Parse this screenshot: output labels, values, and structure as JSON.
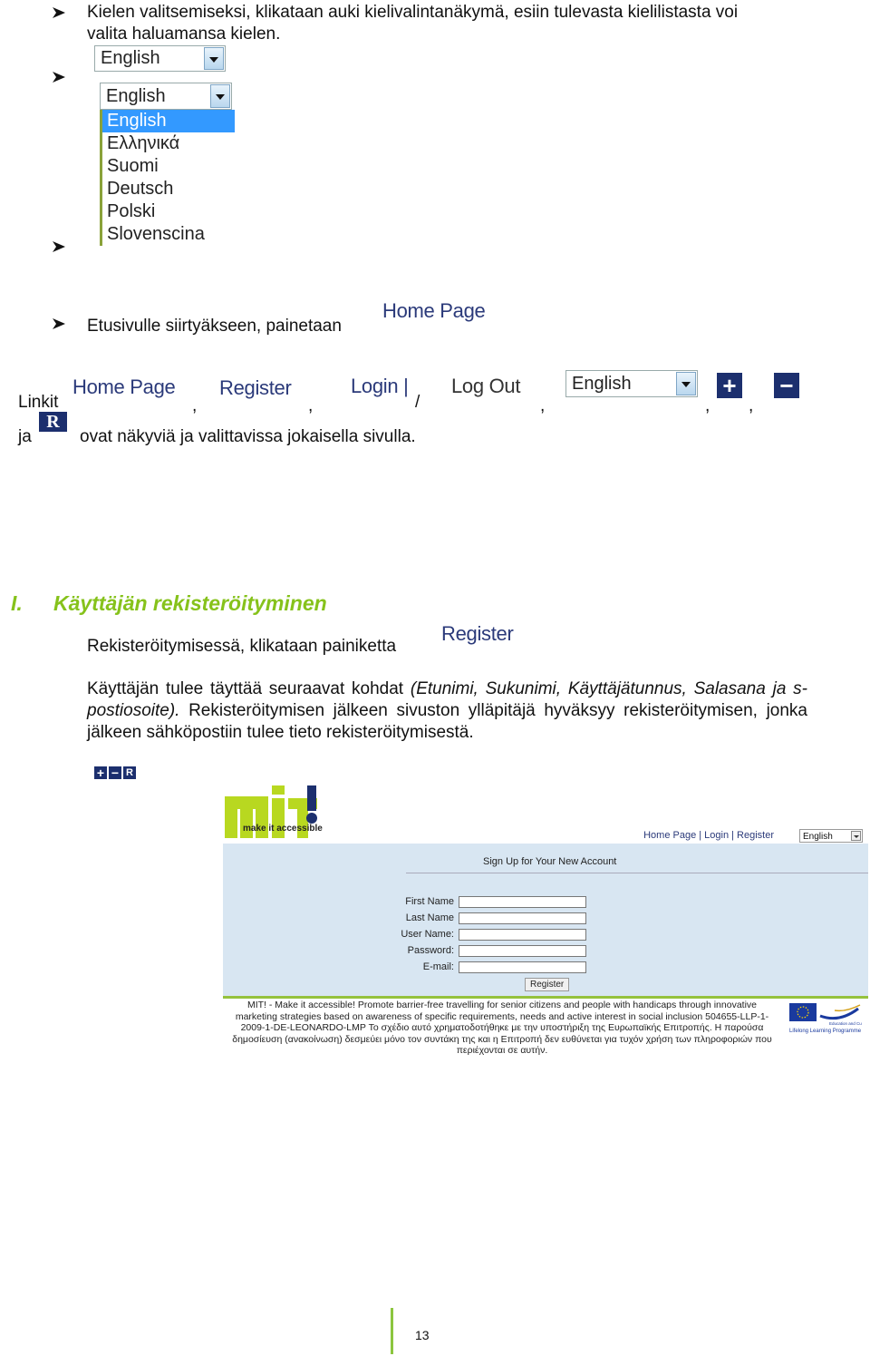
{
  "intro": {
    "line1": "Kielen valitsemiseksi, klikataan auki kielivalintanäkymä, esiin tulevasta kielilistasta voi",
    "line2": "valita haluamansa kielen."
  },
  "language_select": {
    "selected": "English",
    "options": [
      "English",
      "Ελληνικά",
      "Suomi",
      "Deutsch",
      "Polski",
      "Slovenscina"
    ],
    "highlighted": "English"
  },
  "homepage_item": {
    "text": "Etusivulle siirtyäkseen, painetaan",
    "button": "Home Page"
  },
  "links_line": {
    "lead": "Linkit",
    "home": "Home Page",
    "register": "Register",
    "login": "Login |",
    "logout": "Log Out",
    "lang": "English",
    "comma": ",",
    "slash": "/",
    "ja": "ja",
    "tail": "ovat näkyviä ja valittavissa jokaisella sivulla.",
    "plus_icon": "+",
    "minus_icon": "−",
    "r_icon": "R"
  },
  "section": {
    "number": "I.",
    "title": "Käyttäjän rekisteröityminen",
    "register_text": "Rekisteröitymisessä, klikataan painiketta",
    "register_button": "Register",
    "para_a": "Käyttäjän tulee täyttää seuraavat kohdat ",
    "para_b_italic": "(Etunimi, Sukunimi, Käyttäjätunnus, Salasana ja s-postiosoite).",
    "para_c": " Rekisteröitymisen jälkeen sivuston ylläpitäjä hyväksyy rekisteröitymisen, jonka jälkeen sähköpostiin tulee tieto rekisteröitymisestä."
  },
  "site": {
    "logo_tagline": "make it accessible",
    "nav": "Home Page | Login | Register",
    "lang": "English",
    "form_title": "Sign Up for Your New Account",
    "fields": [
      {
        "label": "First Name",
        "value": ""
      },
      {
        "label": "Last Name",
        "value": ""
      },
      {
        "label": "User Name:",
        "value": ""
      },
      {
        "label": "Password:",
        "value": ""
      },
      {
        "label": "E-mail:",
        "value": ""
      }
    ],
    "submit": "Register",
    "footer": "MIT! - Make it accessible! Promote barrier-free travelling for senior citizens and people with handicaps through innovative marketing strategies based on awareness of specific requirements, needs and active interest in social inclusion 504655-LLP-1-2009-1-DE-LEONARDO-LMP Το σχέδιο αυτό χρηματοδοτήθηκε με την υποστήριξη της Ευρωπαϊκής Επιτροπής. Η παρούσα δημοσίευση (ανακοίνωση) δεσμεύει μόνο τον συντάκη της και η Επιτροπή δεν ευθύνεται για τυχόν χρήση των πληροφοριών που περιέχονται σε αυτήν.",
    "eu_caption1": "Education and Culture DG",
    "eu_caption2": "Lifelong Learning Programme"
  },
  "page_number": "13",
  "colors": {
    "heading": "#86c21b",
    "link": "#2b3a7a",
    "icon_bg": "#1c2f6e",
    "highlight": "#3399ff"
  }
}
